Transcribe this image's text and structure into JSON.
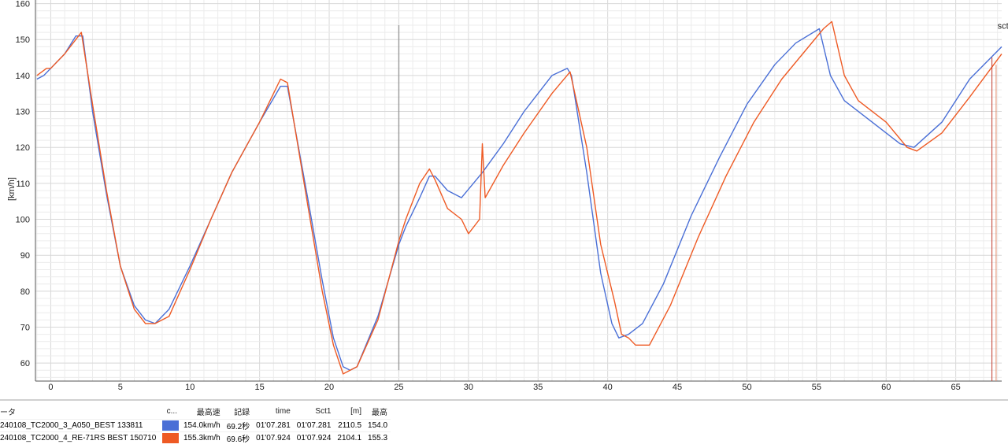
{
  "chart_data": {
    "type": "line",
    "title": "",
    "xlabel": "",
    "ylabel": "[km/h]",
    "xlim": [
      -1.1,
      68.3
    ],
    "ylim": [
      55,
      161
    ],
    "x_ticks": [
      "0",
      "5",
      "10",
      "15",
      "20",
      "25",
      "30",
      "35",
      "40",
      "45",
      "50",
      "55",
      "60",
      "65"
    ],
    "y_ticks": [
      "60",
      "70",
      "80",
      "90",
      "100",
      "110",
      "120",
      "130",
      "140",
      "150",
      "160"
    ],
    "grid": true,
    "cursor_x": 25,
    "annotations": [
      {
        "text": "sct",
        "x": 68,
        "y": 153
      }
    ],
    "series": [
      {
        "name": "240108_TC2000_3_A050_BEST 133811",
        "color": "#4a6fd6",
        "points": [
          [
            -1,
            139
          ],
          [
            -0.5,
            140
          ],
          [
            0,
            142
          ],
          [
            1,
            146
          ],
          [
            1.8,
            151
          ],
          [
            2.3,
            151
          ],
          [
            3,
            130
          ],
          [
            4,
            107
          ],
          [
            5,
            87
          ],
          [
            6,
            76
          ],
          [
            6.8,
            72
          ],
          [
            7.5,
            71
          ],
          [
            8.5,
            75
          ],
          [
            10,
            87
          ],
          [
            11.5,
            100
          ],
          [
            13,
            113
          ],
          [
            15,
            127
          ],
          [
            16.5,
            137
          ],
          [
            17,
            137
          ],
          [
            18.5,
            105
          ],
          [
            19.5,
            83
          ],
          [
            20.3,
            67
          ],
          [
            21,
            59
          ],
          [
            21.5,
            58
          ],
          [
            22,
            59
          ],
          [
            23.5,
            73
          ],
          [
            25,
            93
          ],
          [
            25.5,
            98
          ],
          [
            26.5,
            106
          ],
          [
            27.2,
            112
          ],
          [
            27.6,
            112
          ],
          [
            28.5,
            108
          ],
          [
            29.5,
            106
          ],
          [
            31,
            113
          ],
          [
            32.5,
            121
          ],
          [
            34,
            130
          ],
          [
            36,
            140
          ],
          [
            37.1,
            142
          ],
          [
            37.4,
            140
          ],
          [
            38.5,
            113
          ],
          [
            39.5,
            85
          ],
          [
            40.3,
            71
          ],
          [
            40.8,
            67
          ],
          [
            41.5,
            68
          ],
          [
            42.5,
            71
          ],
          [
            44,
            82
          ],
          [
            46,
            101
          ],
          [
            48,
            117
          ],
          [
            50,
            132
          ],
          [
            52,
            143
          ],
          [
            53.5,
            149
          ],
          [
            55.2,
            153
          ],
          [
            56,
            140
          ],
          [
            57,
            133
          ],
          [
            59,
            127
          ],
          [
            61,
            121
          ],
          [
            62,
            120
          ],
          [
            64,
            127
          ],
          [
            66,
            139
          ],
          [
            68.3,
            148
          ]
        ]
      },
      {
        "name": "240108_TC2000_4_RE-71RS BEST 150710",
        "color": "#ee5a24",
        "points": [
          [
            -1,
            140
          ],
          [
            -0.3,
            142
          ],
          [
            0,
            142
          ],
          [
            1,
            146
          ],
          [
            1.8,
            150
          ],
          [
            2.2,
            152
          ],
          [
            3,
            132
          ],
          [
            4,
            108
          ],
          [
            5,
            87
          ],
          [
            6,
            75
          ],
          [
            6.8,
            71
          ],
          [
            7.5,
            71
          ],
          [
            8.5,
            73
          ],
          [
            10,
            86
          ],
          [
            11.5,
            100
          ],
          [
            13,
            113
          ],
          [
            15,
            127
          ],
          [
            16.5,
            139
          ],
          [
            17,
            138
          ],
          [
            18.5,
            103
          ],
          [
            19.5,
            80
          ],
          [
            20.3,
            65
          ],
          [
            21,
            57
          ],
          [
            21.5,
            58
          ],
          [
            22,
            59
          ],
          [
            23.5,
            72
          ],
          [
            25,
            94
          ],
          [
            25.5,
            100
          ],
          [
            26.5,
            110
          ],
          [
            27.2,
            114
          ],
          [
            27.6,
            111
          ],
          [
            28.5,
            103
          ],
          [
            29.5,
            100
          ],
          [
            30,
            96
          ],
          [
            30.8,
            100
          ],
          [
            31,
            121
          ],
          [
            31.2,
            106
          ],
          [
            32.5,
            115
          ],
          [
            34,
            124
          ],
          [
            36,
            135
          ],
          [
            37.3,
            141
          ],
          [
            38.5,
            120
          ],
          [
            39.5,
            93
          ],
          [
            40.5,
            77
          ],
          [
            41,
            68
          ],
          [
            41.5,
            67
          ],
          [
            42,
            65
          ],
          [
            43,
            65
          ],
          [
            44.5,
            76
          ],
          [
            46.5,
            95
          ],
          [
            48.5,
            112
          ],
          [
            50.5,
            127
          ],
          [
            52.5,
            139
          ],
          [
            54,
            146
          ],
          [
            55.5,
            153
          ],
          [
            56.1,
            155
          ],
          [
            57,
            140
          ],
          [
            58,
            133
          ],
          [
            60,
            127
          ],
          [
            61.5,
            120
          ],
          [
            62.2,
            119
          ],
          [
            64,
            124
          ],
          [
            66,
            134
          ],
          [
            68.3,
            146
          ]
        ]
      }
    ]
  },
  "panel": {
    "headers": [
      "ータ",
      "c...",
      "最高速",
      "記録",
      "time",
      "Sct1",
      "[m]",
      "最高"
    ],
    "rows": [
      {
        "name": "240108_TC2000_3_A050_BEST 133811",
        "color": "#4a6fd6",
        "max_speed": "154.0km/h",
        "record": "69.2秒",
        "time": "01'07.281",
        "sct1": "01'07.281",
        "m": "2110.5",
        "max": "154.0"
      },
      {
        "name": "240108_TC2000_4_RE-71RS BEST 150710",
        "color": "#ee5a24",
        "max_speed": "155.3km/h",
        "record": "69.6秒",
        "time": "01'07.924",
        "sct1": "01'07.924",
        "m": "2104.1",
        "max": "155.3"
      }
    ]
  }
}
